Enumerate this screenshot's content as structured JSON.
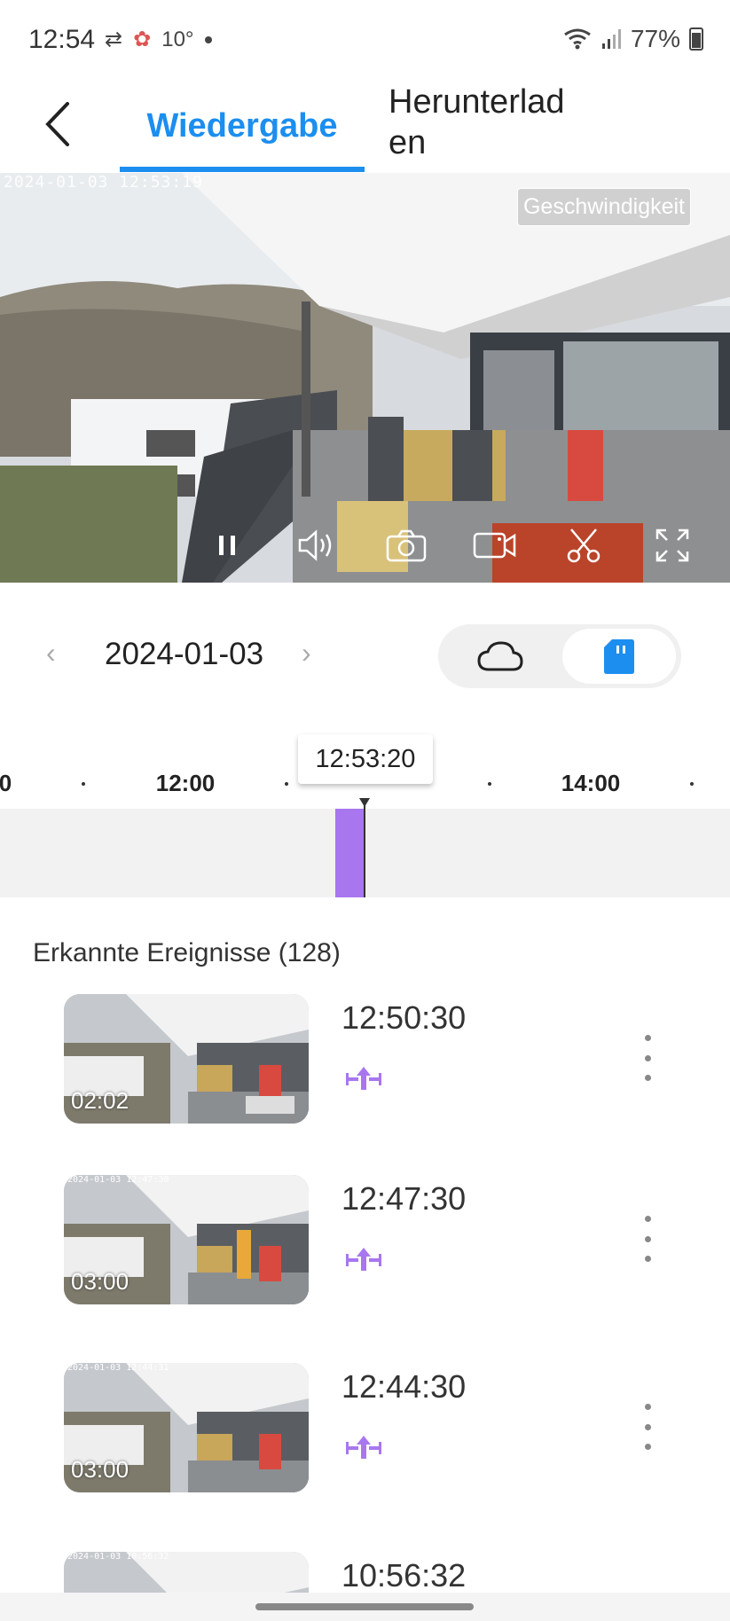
{
  "status_bar": {
    "time": "12:54",
    "temperature": "10°",
    "battery": "77%"
  },
  "header": {
    "tab_playback": "Wiedergabe",
    "tab_download_line1": "Herunterlad",
    "tab_download_line2": "en"
  },
  "video": {
    "timestamp": "2024-01-03 12:53:19",
    "speed_label": "Geschwindigkeit"
  },
  "date_nav": {
    "prev": "‹",
    "date": "2024-01-03",
    "next": "›"
  },
  "timeline": {
    "current_time": "12:53:20",
    "ticks": [
      "0",
      "12:00",
      "14:00"
    ]
  },
  "events": {
    "title": "Erkannte Ereignisse (128)",
    "items": [
      {
        "time": "12:50:30",
        "duration": "02:02",
        "thumb_ts": ""
      },
      {
        "time": "12:47:30",
        "duration": "03:00",
        "thumb_ts": "2024-01-03 12:47:30"
      },
      {
        "time": "12:44:30",
        "duration": "03:00",
        "thumb_ts": "2024-01-03 12:44:31"
      },
      {
        "time": "10:56:32",
        "duration": "",
        "thumb_ts": "2024-01-03 10:56:32"
      }
    ]
  },
  "colors": {
    "accent": "#1c8ef0",
    "event_purple": "#a877f0"
  }
}
